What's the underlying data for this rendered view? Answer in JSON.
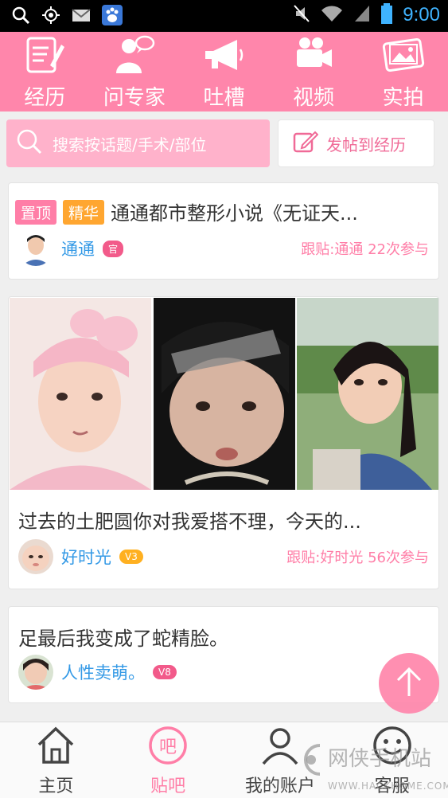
{
  "statusbar": {
    "time": "9:00"
  },
  "topnav": {
    "items": [
      {
        "label": "经历",
        "icon": "diary-icon"
      },
      {
        "label": "问专家",
        "icon": "expert-icon"
      },
      {
        "label": "吐槽",
        "icon": "megaphone-icon"
      },
      {
        "label": "视频",
        "icon": "video-camera-icon"
      },
      {
        "label": "实拍",
        "icon": "photo-icon"
      }
    ],
    "active": "经历"
  },
  "search": {
    "placeholder": "搜索按话题/手术/部位"
  },
  "post_button": {
    "label": "发帖到经历"
  },
  "posts": [
    {
      "tags": [
        "置顶",
        "精华"
      ],
      "title": "通通都市整形小说《无证天...",
      "user": "通通",
      "badge": "官",
      "stat": "跟贴:通通 22次参与"
    },
    {
      "title": "过去的土肥圆你对我爱搭不理，今天的...",
      "user": "好时光",
      "badge": "V3",
      "stat": "跟贴:好时光 56次参与"
    },
    {
      "title": "足最后我变成了蛇精脸。",
      "user": "人性卖萌。",
      "badge": "V8"
    }
  ],
  "bottomnav": {
    "items": [
      {
        "label": "主页",
        "icon": "home-icon"
      },
      {
        "label": "贴吧",
        "icon": "chat-bubble-icon"
      },
      {
        "label": "我的账户",
        "icon": "user-icon"
      },
      {
        "label": "客服",
        "icon": "smiley-icon"
      }
    ],
    "active": "贴吧"
  },
  "watermark": {
    "text": "网侠手机站",
    "url": "WWW.HACKHOME.COM"
  },
  "colors": {
    "accent": "#ff86ab",
    "link": "#3399e6",
    "tag_orange": "#ffa630"
  }
}
